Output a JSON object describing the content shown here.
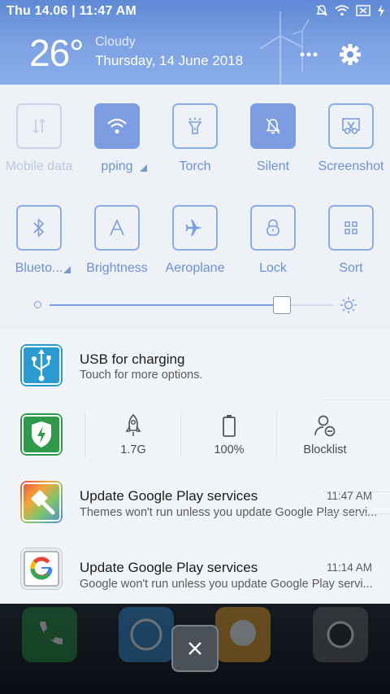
{
  "statusbar": {
    "time_text": "Thu 14.06 | 11:47 AM",
    "icons": [
      "silent-icon",
      "wifi-icon",
      "battery-icon",
      "charging-icon"
    ]
  },
  "header": {
    "temperature": "26°",
    "weather": "Cloudy",
    "date": "Thursday, 14 June 2018",
    "icons": [
      "more-icon",
      "gear-icon"
    ]
  },
  "toggles": [
    {
      "label": "Mobile data",
      "icon": "mobile-data-icon",
      "state": "disabled"
    },
    {
      "label": "pping",
      "icon": "wifi-icon",
      "state": "on",
      "expandable": true
    },
    {
      "label": "Torch",
      "icon": "torch-icon",
      "state": "off"
    },
    {
      "label": "Silent",
      "icon": "silent-icon",
      "state": "on"
    },
    {
      "label": "Screenshot",
      "icon": "screenshot-icon",
      "state": "off"
    },
    {
      "label": "Blueto...",
      "icon": "bluetooth-icon",
      "state": "off",
      "expandable": true
    },
    {
      "label": "Brightness",
      "icon": "brightness-auto-icon",
      "state": "off"
    },
    {
      "label": "Aeroplane",
      "icon": "aeroplane-icon",
      "state": "off"
    },
    {
      "label": "Lock",
      "icon": "lock-icon",
      "state": "off"
    },
    {
      "label": "Sort",
      "icon": "sort-grid-icon",
      "state": "off"
    }
  ],
  "brightness": {
    "level": 0.82
  },
  "notifications": {
    "usb": {
      "title": "USB for charging",
      "subtitle": "Touch for more options."
    },
    "security_stats": [
      {
        "value": "1.7G",
        "icon": "rocket-icon"
      },
      {
        "value": "100%",
        "icon": "battery-icon"
      },
      {
        "value": "Blocklist",
        "icon": "blocklist-icon"
      }
    ],
    "items": [
      {
        "title": "Update Google Play services",
        "subtitle": "Themes won't run unless you update Google Play servi...",
        "time": "11:47 AM",
        "icon": "themes-icon"
      },
      {
        "title": "Update Google Play services",
        "subtitle": "Google won't run unless you update Google Play servi...",
        "time": "11:14 AM",
        "icon": "google-icon"
      }
    ]
  },
  "colors": {
    "accent": "#7c9de1",
    "header_top": "#5f89d6",
    "panel_bg": "#eef2f7"
  }
}
